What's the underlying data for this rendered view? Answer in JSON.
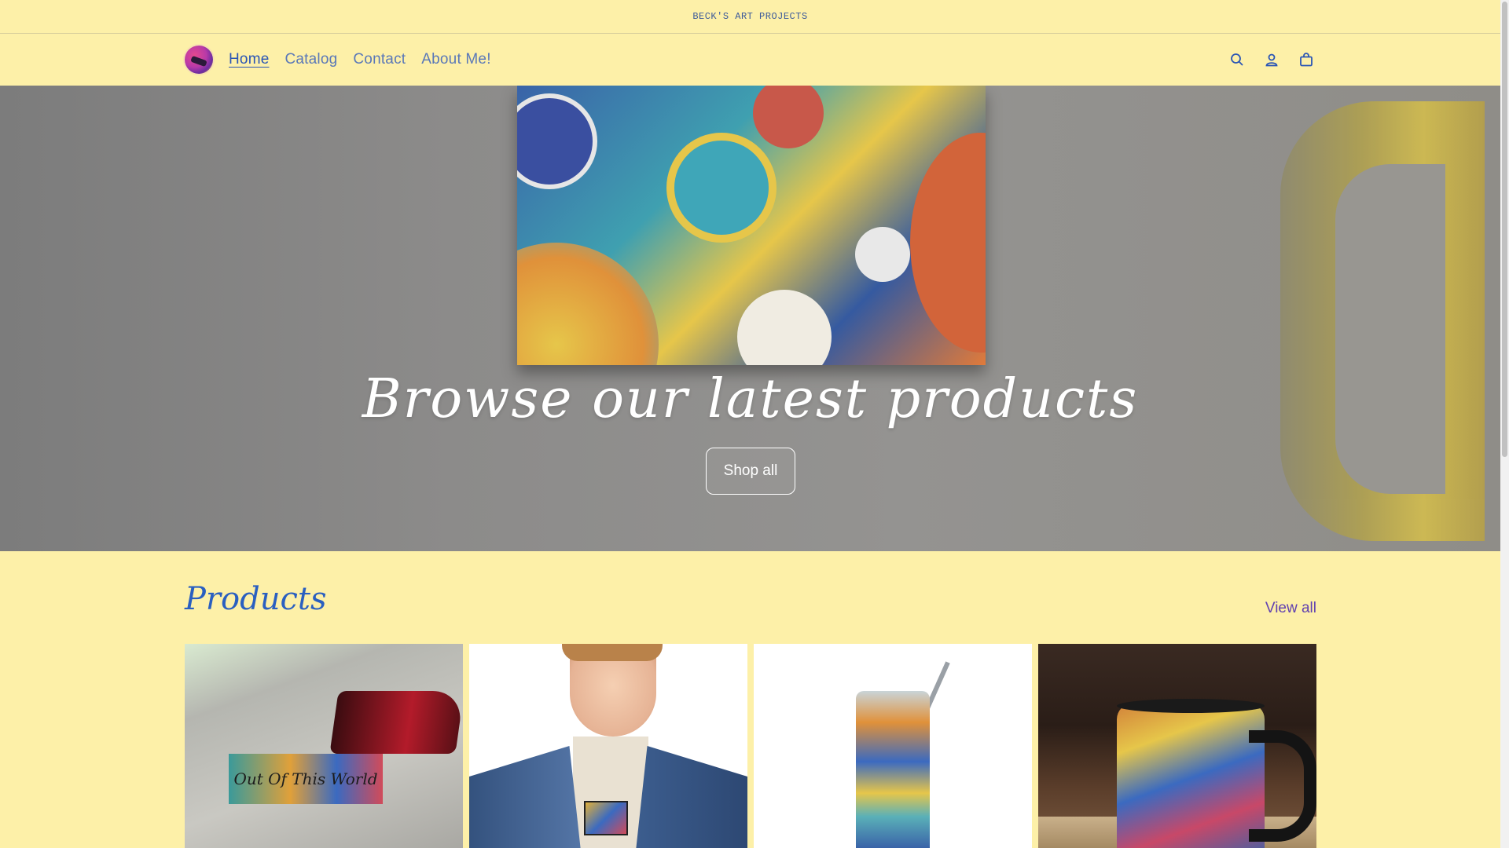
{
  "announcement": {
    "text": "BECK'S ART PROJECTS"
  },
  "nav": {
    "items": [
      {
        "label": "Home",
        "active": true
      },
      {
        "label": "Catalog"
      },
      {
        "label": "Contact"
      },
      {
        "label": "About Me!"
      }
    ]
  },
  "header_icons": [
    "search-icon",
    "account-icon",
    "cart-icon"
  ],
  "hero": {
    "title": "Browse our latest products",
    "button": "Shop all"
  },
  "products": {
    "title": "Products",
    "view_all": "View all",
    "cards": [
      {
        "image_text": "Out Of This World"
      },
      {
        "image_text": ""
      },
      {
        "image_text": ""
      },
      {
        "image_text": ""
      }
    ]
  },
  "colors": {
    "background": "#fdf0a8",
    "link": "#5a78b8",
    "active_link": "#2a55b5",
    "heading": "#2a5fc0"
  }
}
